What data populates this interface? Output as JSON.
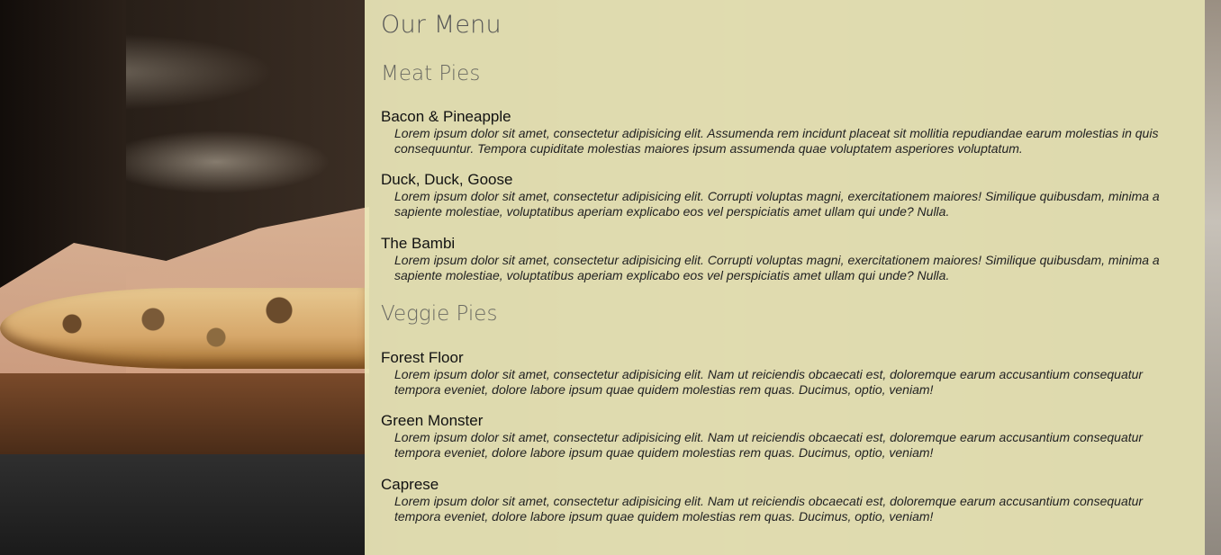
{
  "menu": {
    "title": "Our Menu",
    "sections": [
      {
        "heading": "Meat Pies",
        "items": [
          {
            "name": "Bacon & Pineapple",
            "description": "Lorem ipsum dolor sit amet, consectetur adipisicing elit. Assumenda rem incidunt placeat sit mollitia repudiandae earum molestias in quis consequuntur. Tempora cupiditate molestias maiores ipsum assumenda quae voluptatem asperiores voluptatum."
          },
          {
            "name": "Duck, Duck, Goose",
            "description": "Lorem ipsum dolor sit amet, consectetur adipisicing elit. Corrupti voluptas magni, exercitationem maiores! Similique quibusdam, minima a sapiente molestiae, voluptatibus aperiam explicabo eos vel perspiciatis amet ullam qui unde? Nulla."
          },
          {
            "name": "The Bambi",
            "description": "Lorem ipsum dolor sit amet, consectetur adipisicing elit. Corrupti voluptas magni, exercitationem maiores! Similique quibusdam, minima a sapiente molestiae, voluptatibus aperiam explicabo eos vel perspiciatis amet ullam qui unde? Nulla."
          }
        ]
      },
      {
        "heading": "Veggie Pies",
        "items": [
          {
            "name": "Forest Floor",
            "description": "Lorem ipsum dolor sit amet, consectetur adipisicing elit. Nam ut reiciendis obcaecati est, doloremque earum accusantium consequatur tempora eveniet, dolore labore ipsum quae quidem molestias rem quas. Ducimus, optio, veniam!"
          },
          {
            "name": "Green Monster",
            "description": "Lorem ipsum dolor sit amet, consectetur adipisicing elit. Nam ut reiciendis obcaecati est, doloremque earum accusantium consequatur tempora eveniet, dolore labore ipsum quae quidem molestias rem quas. Ducimus, optio, veniam!"
          },
          {
            "name": "Caprese",
            "description": "Lorem ipsum dolor sit amet, consectetur adipisicing elit. Nam ut reiciendis obcaecati est, doloremque earum accusantium consequatur tempora eveniet, dolore labore ipsum quae quidem molestias rem quas. Ducimus, optio, veniam!"
          }
        ]
      }
    ]
  }
}
